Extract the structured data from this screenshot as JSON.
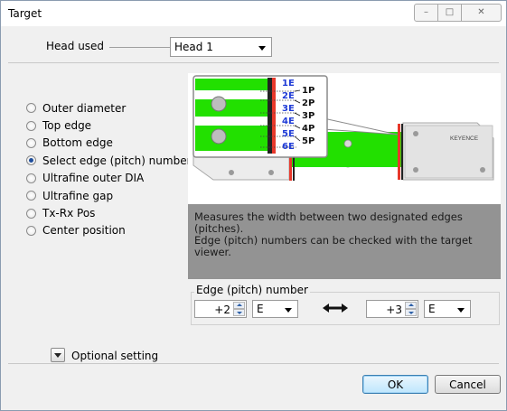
{
  "window": {
    "title": "Target"
  },
  "head": {
    "label": "Head used",
    "selected": "Head 1"
  },
  "modes": [
    {
      "label": "Outer diameter",
      "checked": false
    },
    {
      "label": "Top edge",
      "checked": false
    },
    {
      "label": "Bottom edge",
      "checked": false
    },
    {
      "label": "Select edge (pitch) number",
      "checked": true
    },
    {
      "label": "Ultrafine outer DIA",
      "checked": false
    },
    {
      "label": "Ultrafine gap",
      "checked": false
    },
    {
      "label": "Tx-Rx Pos",
      "checked": false
    },
    {
      "label": "Center position",
      "checked": false
    }
  ],
  "illustration": {
    "edge_labels": [
      "1E",
      "2E",
      "3E",
      "4E",
      "5E",
      "6E"
    ],
    "pitch_labels": [
      "1P",
      "2P",
      "3P",
      "4P",
      "5P"
    ],
    "brand": "KEYENCE"
  },
  "description": {
    "line1": "Measures the width between two designated edges (pitches).",
    "line2": "Edge (pitch) numbers can be checked with the target viewer."
  },
  "edge_pitch": {
    "title": "Edge (pitch) number",
    "from_value": "+2",
    "from_type": "E",
    "to_value": "+3",
    "to_type": "E"
  },
  "optional": {
    "label": "Optional setting"
  },
  "buttons": {
    "ok": "OK",
    "cancel": "Cancel"
  },
  "colors": {
    "accent_green": "#22e000",
    "desc_bg": "#939393",
    "edge_red": "#e8382b",
    "label_blue": "#1f3bd6"
  }
}
